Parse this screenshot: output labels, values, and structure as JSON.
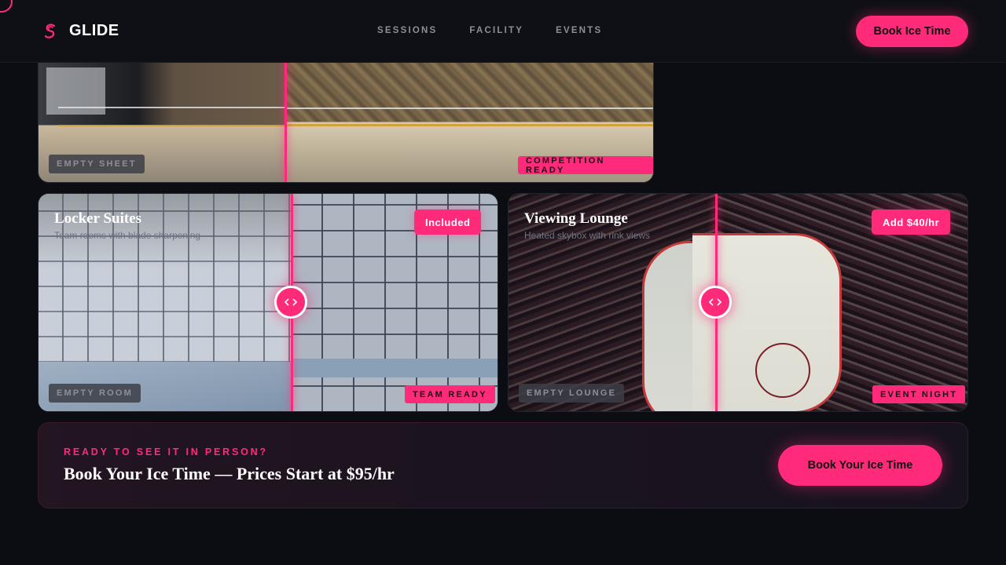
{
  "nav": {
    "brand": "GLIDE",
    "links": [
      "SESSIONS",
      "FACILITY",
      "EVENTS"
    ],
    "cta_label": "Book Ice Time"
  },
  "cards": {
    "rink": {
      "before_tag": "EMPTY SHEET",
      "after_tag": "COMPETITION READY"
    },
    "locker": {
      "title": "Locker Suites",
      "subtitle": "Team rooms with blade sharpening",
      "badge": "Included",
      "before_tag": "EMPTY ROOM",
      "after_tag": "TEAM READY"
    },
    "lounge": {
      "title": "Viewing Lounge",
      "subtitle": "Heated skybox with rink views",
      "badge": "Add $40/hr",
      "before_tag": "EMPTY LOUNGE",
      "after_tag": "EVENT NIGHT"
    }
  },
  "banner": {
    "kicker": "READY TO SEE IT IN PERSON?",
    "title": "Book Your Ice Time — Prices Start at $95/hr",
    "button_label": "Book Your Ice Time"
  },
  "colors": {
    "accent": "#ff2a7a",
    "background": "#0b0d13"
  },
  "icons": {
    "logo": "glide-logo-icon",
    "handle": "compare-arrows-icon"
  }
}
